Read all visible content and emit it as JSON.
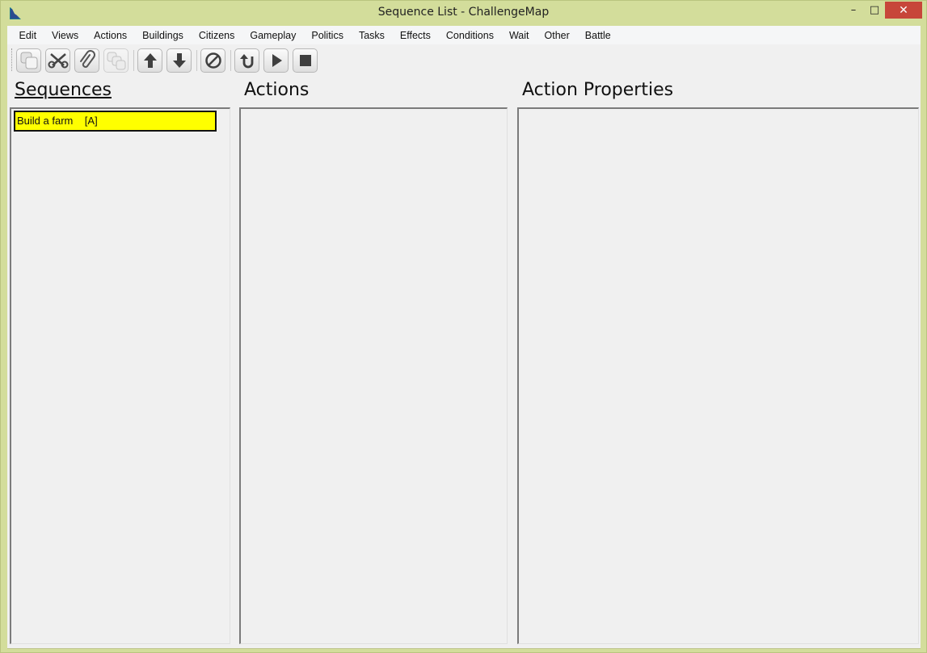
{
  "window": {
    "title": "Sequence List - ChallengeMap",
    "controls": {
      "minimize": "–",
      "maximize": "□",
      "close": "✕"
    }
  },
  "menu": {
    "items": [
      "Edit",
      "Views",
      "Actions",
      "Buildings",
      "Citizens",
      "Gameplay",
      "Politics",
      "Tasks",
      "Effects",
      "Conditions",
      "Wait",
      "Other",
      "Battle"
    ]
  },
  "toolbar": {
    "buttons": [
      {
        "icon": "copy-icon"
      },
      {
        "icon": "cut-icon"
      },
      {
        "icon": "paste-icon"
      },
      {
        "icon": "duplicate-icon"
      },
      {
        "icon": "arrow-up-icon"
      },
      {
        "icon": "arrow-down-icon"
      },
      {
        "icon": "disable-icon"
      },
      {
        "icon": "undo-icon"
      },
      {
        "icon": "play-icon"
      },
      {
        "icon": "stop-icon"
      }
    ]
  },
  "panes": {
    "sequences": {
      "title": "Sequences",
      "items": [
        {
          "label": "Build a farm    [A]",
          "highlight": "#ffff00"
        }
      ]
    },
    "actions": {
      "title": "Actions"
    },
    "properties": {
      "title": "Action Properties"
    }
  },
  "colors": {
    "frame": "#d3dd9b",
    "close": "#c7463a",
    "selection": "#ffff00"
  }
}
